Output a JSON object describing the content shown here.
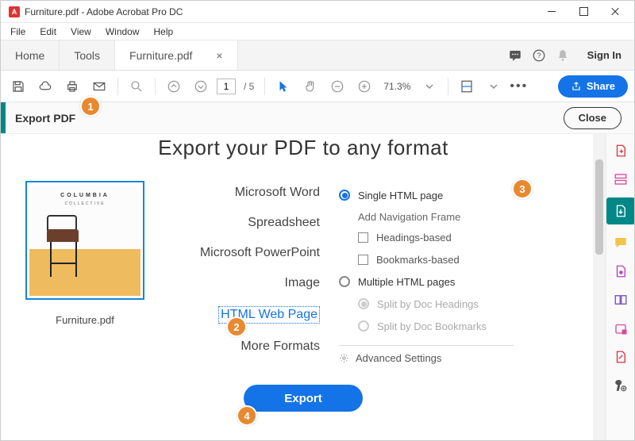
{
  "window": {
    "title": "Furniture.pdf - Adobe Acrobat Pro DC"
  },
  "menubar": [
    "File",
    "Edit",
    "View",
    "Window",
    "Help"
  ],
  "tabs": {
    "home": "Home",
    "tools": "Tools",
    "doc": "Furniture.pdf",
    "sign_in": "Sign In"
  },
  "toolbar": {
    "page_current": "1",
    "page_total": "/ 5",
    "zoom": "71.3%",
    "share": "Share"
  },
  "panel": {
    "label": "Export PDF",
    "close": "Close",
    "title": "Export your PDF to any format",
    "thumb_label": "Furniture.pdf",
    "thumb_brand1": "COLUMBIA",
    "thumb_brand2": "COLLECTIVE",
    "formats": {
      "word": "Microsoft Word",
      "spreadsheet": "Spreadsheet",
      "ppt": "Microsoft PowerPoint",
      "image": "Image",
      "html": "HTML Web Page",
      "more": "More Formats"
    },
    "options": {
      "single": "Single HTML page",
      "nav_title": "Add Navigation Frame",
      "headings": "Headings-based",
      "bookmarks": "Bookmarks-based",
      "multiple": "Multiple HTML pages",
      "split_headings": "Split by Doc Headings",
      "split_bookmarks": "Split by Doc Bookmarks",
      "advanced": "Advanced Settings"
    },
    "export_btn": "Export"
  },
  "badges": {
    "b1": "1",
    "b2": "2",
    "b3": "3",
    "b4": "4"
  }
}
